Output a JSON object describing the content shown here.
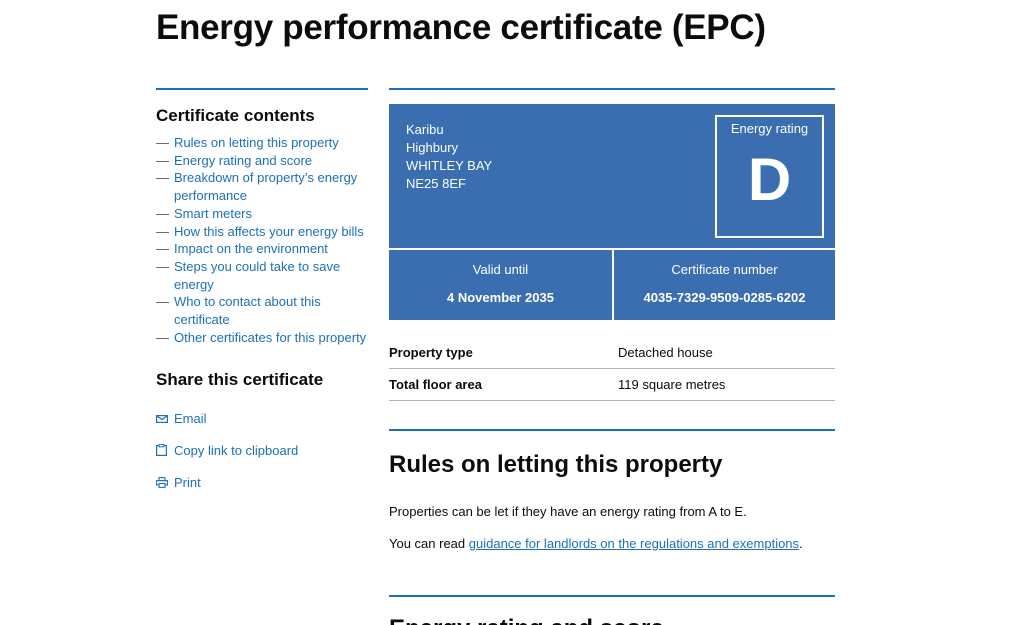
{
  "page_title": "Energy performance certificate (EPC)",
  "contents": {
    "title": "Certificate contents",
    "items": [
      "Rules on letting this property",
      "Energy rating and score",
      "Breakdown of property’s energy performance",
      "Smart meters",
      "How this affects your energy bills",
      "Impact on the environment",
      "Steps you could take to save energy",
      "Who to contact about this certificate",
      "Other certificates for this property"
    ]
  },
  "share": {
    "title": "Share this certificate",
    "items": [
      {
        "label": "Email",
        "icon": "envelope-icon"
      },
      {
        "label": "Copy link to clipboard",
        "icon": "clipboard-icon"
      },
      {
        "label": "Print",
        "icon": "printer-icon"
      }
    ]
  },
  "epc": {
    "address": [
      "Karibu",
      "Highbury",
      "WHITLEY BAY",
      "NE25 8EF"
    ],
    "rating_label": "Energy rating",
    "rating": "D",
    "valid_until_label": "Valid until",
    "valid_until": "4 November 2035",
    "cert_number_label": "Certificate number",
    "cert_number": "4035-7329-9509-0285-6202",
    "box_color": "#3a6eb0"
  },
  "summary": [
    {
      "key": "Property type",
      "value": "Detached house"
    },
    {
      "key": "Total floor area",
      "value": "119 square metres"
    }
  ],
  "rules": {
    "heading": "Rules on letting this property",
    "p1": "Properties can be let if they have an energy rating from A to E.",
    "p2_prefix": "You can read ",
    "p2_link": "guidance for landlords on the regulations and exemptions",
    "p2_suffix": "."
  },
  "next_section": {
    "heading": "Energy rating and score"
  },
  "colors": {
    "link": "#1d70b8",
    "text": "#0b0c0c"
  }
}
